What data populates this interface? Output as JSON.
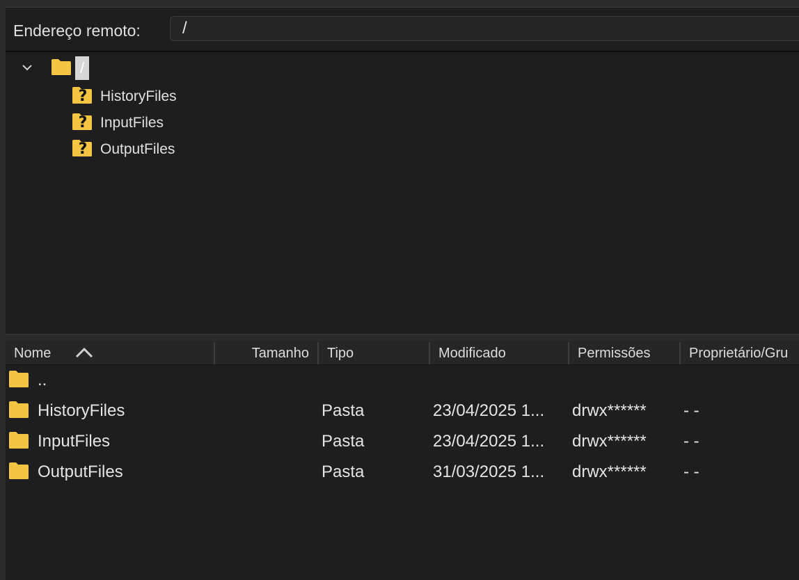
{
  "address_bar": {
    "label": "Endereço remoto:",
    "value": "/"
  },
  "tree": {
    "root": {
      "label": "/",
      "icon": "folder-icon"
    },
    "children": [
      {
        "label": "HistoryFiles",
        "icon": "unknown-folder-icon"
      },
      {
        "label": "InputFiles",
        "icon": "unknown-folder-icon"
      },
      {
        "label": "OutputFiles",
        "icon": "unknown-folder-icon"
      }
    ]
  },
  "file_list": {
    "columns": [
      "Nome",
      "Tamanho",
      "Tipo",
      "Modificado",
      "Permissões",
      "Proprietário/Gru"
    ],
    "sort_column": "Nome",
    "sort_direction": "ascending",
    "rows": [
      {
        "name": "..",
        "size": "",
        "type": "",
        "modified": "",
        "permissions": "",
        "owner": ""
      },
      {
        "name": "HistoryFiles",
        "size": "",
        "type": "Pasta",
        "modified": "23/04/2025 1...",
        "permissions": "drwx******",
        "owner": "- -"
      },
      {
        "name": "InputFiles",
        "size": "",
        "type": "Pasta",
        "modified": "23/04/2025 1...",
        "permissions": "drwx******",
        "owner": "- -"
      },
      {
        "name": "OutputFiles",
        "size": "",
        "type": "Pasta",
        "modified": "31/03/2025 1...",
        "permissions": "drwx******",
        "owner": "- -"
      }
    ]
  },
  "colors": {
    "folder": "#f4c542",
    "background": "#1e1e1e",
    "header": "#262626"
  }
}
